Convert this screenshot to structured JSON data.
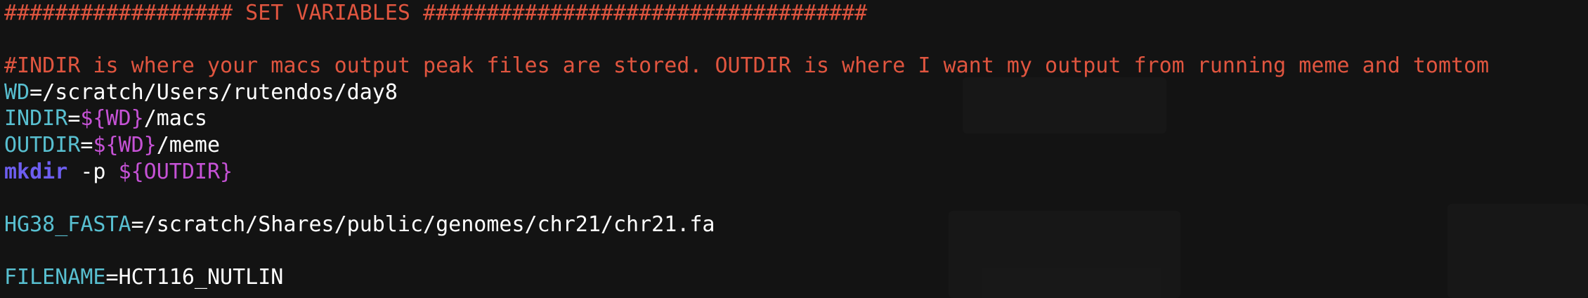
{
  "terminal": {
    "line1": {
      "text": "################## SET VARIABLES ###################################"
    },
    "line3": {
      "text": "#INDIR is where your macs output peak files are stored. OUTDIR is where I want my output from running meme and tomtom"
    },
    "line4": {
      "var": "WD",
      "eq": "=",
      "value": "/scratch/Users/rutendos/day8"
    },
    "line5": {
      "var": "INDIR",
      "eq": "=",
      "sub": "${WD}",
      "value": "/macs"
    },
    "line6": {
      "var": "OUTDIR",
      "eq": "=",
      "sub": "${WD}",
      "value": "/meme"
    },
    "line7": {
      "cmd": "mkdir",
      "flag": " -p ",
      "sub": "${OUTDIR}"
    },
    "line9": {
      "var": "HG38_FASTA",
      "eq": "=",
      "value": "/scratch/Shares/public/genomes/chr21/chr21.fa"
    },
    "line11": {
      "var": "FILENAME",
      "eq": "=",
      "value": "HCT116_NUTLIN"
    }
  },
  "colors": {
    "background": "#131313",
    "comment": "#e0553f",
    "variable": "#58bfd0",
    "substitution": "#c552d5",
    "command": "#6d5ef0",
    "plain": "#ffffff"
  }
}
